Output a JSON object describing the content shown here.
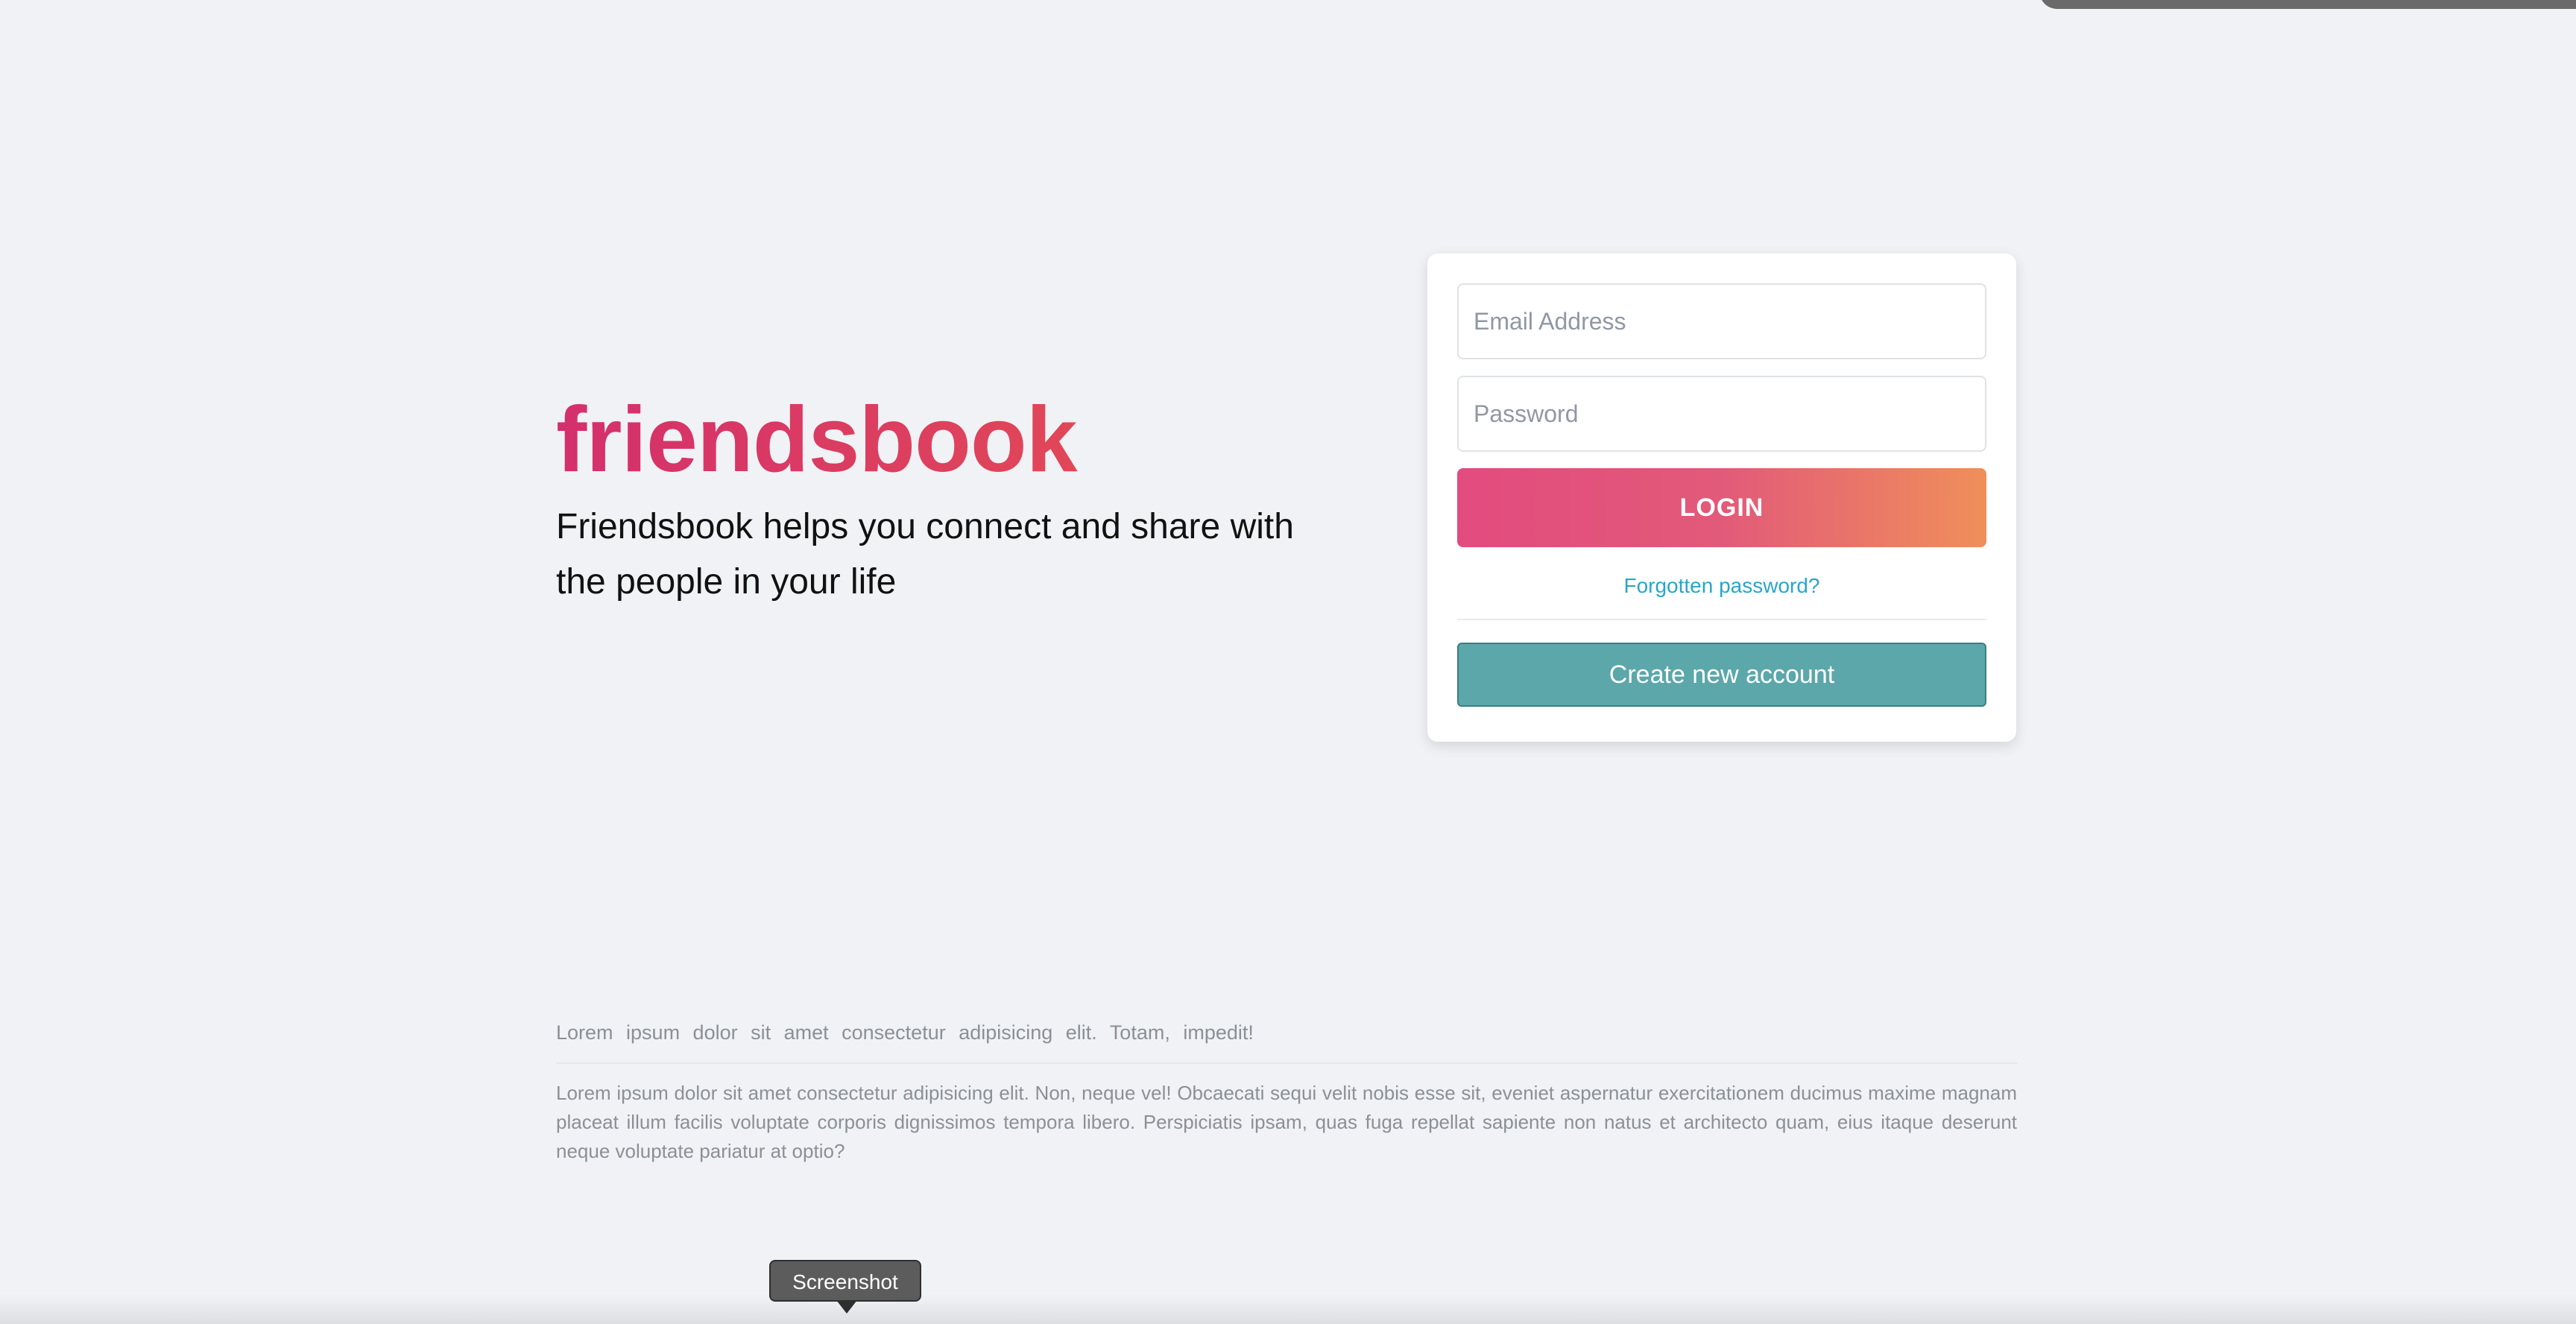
{
  "brand": {
    "logo": "friendsbook",
    "tagline": "Friendsbook helps you connect and share with the people in your life"
  },
  "login": {
    "email_placeholder": "Email Address",
    "password_placeholder": "Password",
    "login_label": "LOGIN",
    "forgot_label": "Forgotten password?",
    "create_label": "Create new account"
  },
  "footer": {
    "line": "Lorem ipsum dolor sit amet consectetur adipisicing elit. Totam, impedit!",
    "paragraph": "Lorem ipsum dolor sit amet consectetur adipisicing elit. Non, neque vel! Obcaecati sequi velit nobis esse sit, eveniet aspernatur exercitationem ducimus maxime magnam placeat illum facilis voluptate corporis dignissimos tempora libero. Perspiciatis ipsam, quas fuga repellat sapiente non natus et architecto quam, eius itaque deserunt neque voluptate pariatur at optio?"
  },
  "tooltip": {
    "text": "Screenshot"
  },
  "colors": {
    "background": "#f0f2f5",
    "logo_gradient_start": "#d42f6d",
    "logo_gradient_end": "#e8554b",
    "login_gradient_start": "#e24b7e",
    "login_gradient_end": "#f08f5a",
    "link": "#28a6c7",
    "create_button": "#5ba7aa"
  }
}
